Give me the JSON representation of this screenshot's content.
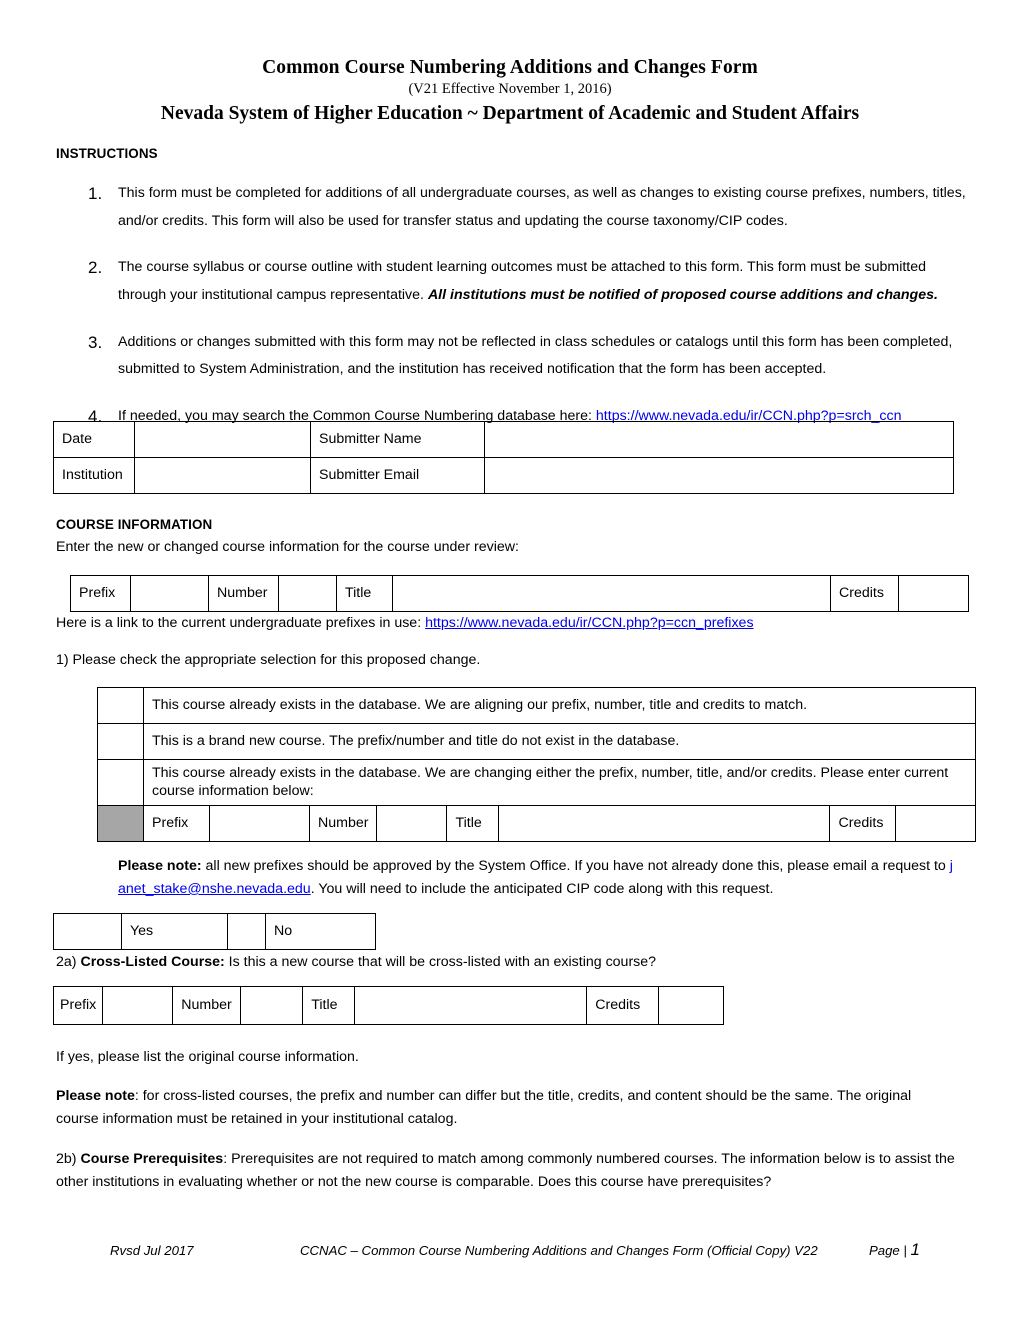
{
  "document": {
    "title_main": "Common Course Numbering Additions and Changes Form",
    "title_version": "(V21 Effective November 1, 2016)",
    "title_org": "Nevada System of Higher Education ~ Department of Academic and Student Affairs"
  },
  "instructions": {
    "heading": "INSTRUCTIONS",
    "items": [
      {
        "number": "1.",
        "text": "This form must be completed for additions of all undergraduate courses, as well as changes to existing course prefixes, numbers, titles, and/or credits. This form will also be used for transfer status and updating the course taxonomy/CIP codes."
      },
      {
        "number": "2.",
        "text_before": "The course syllabus or course outline with student learning outcomes must be attached to this form. This form must be submitted through your institutional campus representative. ",
        "emphasis": "All institutions must be notified of proposed course additions and changes."
      },
      {
        "number": "3.",
        "text": "Additions or changes submitted with this form may not be reflected in class schedules or catalogs until this form has been completed, submitted to System Administration, and the institution has received notification that the form has been accepted."
      },
      {
        "number": "4.",
        "text_before": "If needed, you may search the Common Course Numbering database here: ",
        "link": "https://www.nevada.edu/ir/CCN.php?p=srch_ccn"
      }
    ]
  },
  "submitter_table": {
    "rows": [
      {
        "label_left": "Date",
        "value_left": "",
        "label_right": "Submitter Name",
        "value_right": ""
      },
      {
        "label_left": "Institution",
        "value_left": "",
        "label_right": "Submitter Email",
        "value_right": ""
      }
    ]
  },
  "course_information": {
    "heading": "COURSE INFORMATION",
    "subtext": "Enter the new or changed course information for the course under review:",
    "fields": {
      "prefix": "Prefix",
      "prefix_value": "",
      "number": "Number",
      "number_value": "",
      "title": "Title",
      "title_value": "",
      "credits": "Credits",
      "credits_value": ""
    },
    "prefix_link_text": "Here is a link to the current undergraduate prefixes in use: ",
    "prefix_link_url": "https://www.nevada.edu/ir/CCN.php?p=ccn_prefixes"
  },
  "selection": {
    "prompt": "1) Please check the appropriate selection for this proposed change.",
    "options": [
      {
        "checked": "",
        "text": "This course already exists in the database. We are aligning our prefix, number, title and credits to match."
      },
      {
        "checked": "",
        "text": "This is a brand new course. The prefix/number and title do not exist in the database."
      },
      {
        "checked": "",
        "text": "This course already exists in the database. We are changing either the prefix, number, title, and/or credits. Please enter current course information below:"
      }
    ],
    "current_course_row": {
      "prefix": "Prefix",
      "prefix_value": "",
      "number": "Number",
      "number_value": "",
      "title": "Title",
      "title_value": "",
      "credits": "Credits",
      "credits_value": ""
    },
    "shaded_cell_color": "#a6a6a6"
  },
  "please_note_prefix": {
    "bold_lead": "Please note:",
    "text_before": " all new prefixes should be approved by the System Office. If you have not already done this, please email a request to ",
    "email": "janet_stake@nshe.nevada.edu",
    "text_after": ". You will need to include the anticipated CIP code along with this request."
  },
  "yes_no_table": {
    "yes_box": "",
    "yes_label": "Yes",
    "no_box": "",
    "no_label": "No"
  },
  "crosslisted": {
    "prefix_label": "2a) ",
    "bold_label": "Cross-Listed Course:",
    "question": " Is this a new course that will be cross-listed with an existing course?",
    "fields": {
      "prefix": "Prefix",
      "prefix_value": "",
      "number": "Number",
      "number_value": "",
      "title": "Title",
      "title_value": "",
      "credits": "Credits",
      "credits_value": ""
    },
    "if_yes": "If yes, please list the original course information.",
    "note_bold": "Please note",
    "note_text": ": for cross-listed courses, the prefix and number can differ but the title, credits, and content should be the same. The original course information must be retained in your institutional catalog."
  },
  "prerequisites": {
    "prefix_label": "2b) ",
    "bold_label": "Course Prerequisites",
    "text": ": Prerequisites are not required to match among commonly numbered courses. The information below is to assist the other institutions in evaluating whether or not the new course is comparable. Does this course have prerequisites?"
  },
  "footer": {
    "revision": "Rvsd Jul 2017",
    "center": "CCNAC – Common Course Numbering Additions and Changes Form (Official Copy) V22",
    "page_label": "Page | ",
    "page_number": "1"
  },
  "colors": {
    "link": "#0000ee",
    "shaded": "#a6a6a6",
    "border": "#000000"
  }
}
